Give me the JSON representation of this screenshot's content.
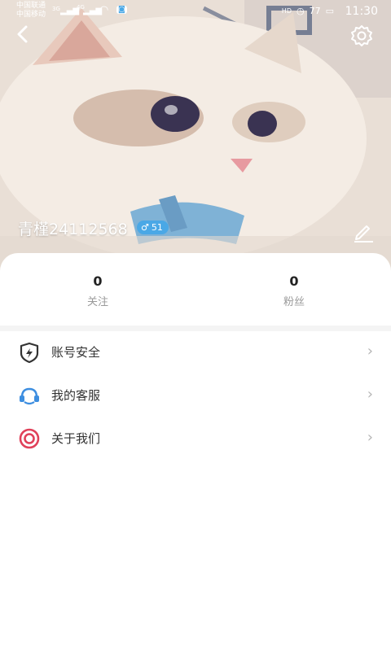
{
  "status_bar": {
    "carrier_1": "中国联通",
    "carrier_2": "中国移动",
    "net_1": "3G",
    "net_2": "4G",
    "battery_text": "77",
    "time": "11:30"
  },
  "profile": {
    "username": "青槿24112568",
    "gender_symbol": "♂",
    "age": "51"
  },
  "stats": {
    "follow_count": "0",
    "follow_label": "关注",
    "fans_count": "0",
    "fans_label": "粉丝"
  },
  "menu": [
    {
      "label": "账号安全",
      "icon": "shield-lightning-icon",
      "color": "#333333"
    },
    {
      "label": "我的客服",
      "icon": "headset-icon",
      "color": "#3d8ee0"
    },
    {
      "label": "关于我们",
      "icon": "target-icon",
      "color": "#e0415a"
    }
  ],
  "colors": {
    "badge": "#4aa8e6",
    "chevron": "#b5b5b5"
  }
}
